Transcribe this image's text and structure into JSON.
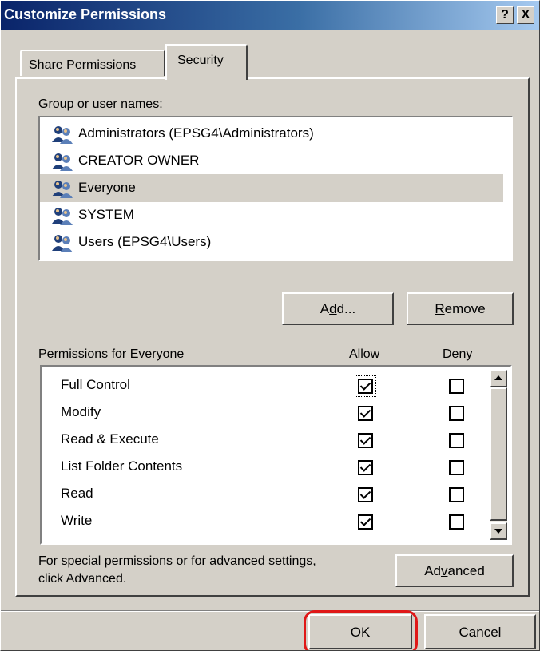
{
  "window": {
    "title": "Customize Permissions",
    "help_label": "?",
    "close_label": "X"
  },
  "tabs": [
    {
      "label": "Share Permissions"
    },
    {
      "label": "Security"
    }
  ],
  "group_section": {
    "label_accel": "G",
    "label_rest": "roup or user names:",
    "users": [
      {
        "name": "Administrators (EPSG4\\Administrators)"
      },
      {
        "name": "CREATOR OWNER"
      },
      {
        "name": "Everyone"
      },
      {
        "name": "SYSTEM"
      },
      {
        "name": "Users (EPSG4\\Users)"
      }
    ],
    "selected_user": "Everyone"
  },
  "buttons": {
    "add": {
      "pre": "A",
      "accel": "d",
      "post": "d..."
    },
    "remove": {
      "pre": "",
      "accel": "R",
      "post": "emove"
    },
    "advanced": {
      "pre": "Ad",
      "accel": "v",
      "post": "anced"
    },
    "ok": {
      "label": "OK"
    },
    "cancel": {
      "label": "Cancel"
    }
  },
  "permissions_section": {
    "label_accel": "P",
    "label_rest": "ermissions for Everyone",
    "allow_header": "Allow",
    "deny_header": "Deny",
    "items": [
      {
        "name": "Full Control",
        "allow": true,
        "deny": false
      },
      {
        "name": "Modify",
        "allow": true,
        "deny": false
      },
      {
        "name": "Read & Execute",
        "allow": true,
        "deny": false
      },
      {
        "name": "List Folder Contents",
        "allow": true,
        "deny": false
      },
      {
        "name": "Read",
        "allow": true,
        "deny": false
      },
      {
        "name": "Write",
        "allow": true,
        "deny": false
      }
    ]
  },
  "advanced_note": {
    "line1": "For special permissions or for advanced settings,",
    "line2": "click Advanced."
  },
  "icons": {
    "user_group": "user-group-icon",
    "scroll_up": "scroll-up-arrow-icon",
    "scroll_down": "scroll-down-arrow-icon"
  },
  "colors": {
    "titlebar_start": "#0a246a",
    "titlebar_end": "#a6caf0",
    "face": "#d4d0c8",
    "highlight_ring": "#e01818"
  }
}
